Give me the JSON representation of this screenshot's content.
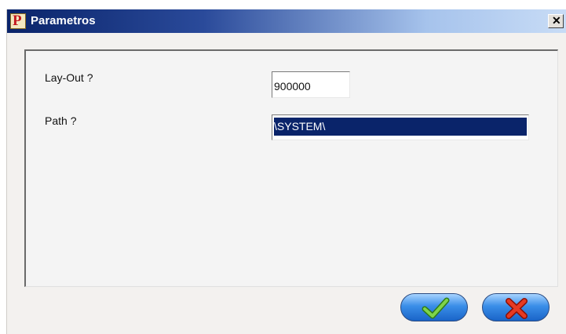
{
  "window": {
    "title": "Parametros",
    "app_icon": "app-logo-icon",
    "app_icon_letter": "P",
    "close_icon": "close-icon",
    "close_glyph": "✕"
  },
  "form": {
    "layout_label": "Lay-Out ?",
    "layout_value": "900000",
    "path_label": "Path ?",
    "path_value": "\\SYSTEM\\"
  },
  "buttons": {
    "ok_icon": "checkmark-icon",
    "cancel_icon": "x-icon"
  },
  "colors": {
    "titlebar_start": "#0a246a",
    "titlebar_end": "#c8dcf6",
    "selection": "#0a246a",
    "ok_check": "#4caa2a",
    "cancel_x": "#d42a1a"
  }
}
